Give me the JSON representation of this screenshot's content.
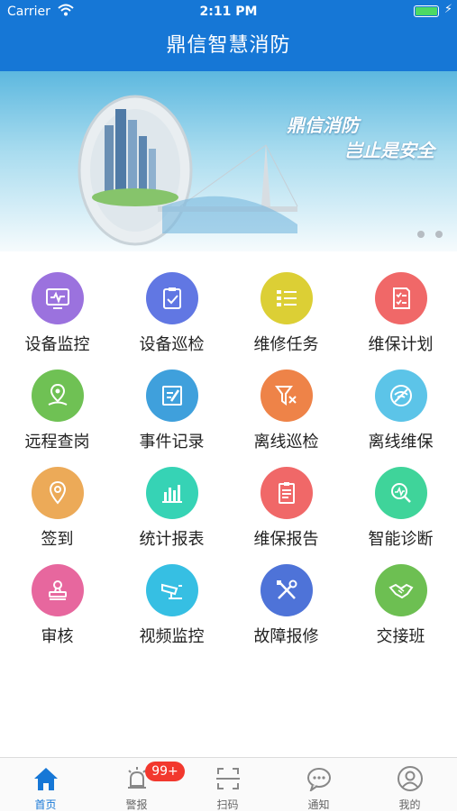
{
  "status_bar": {
    "carrier": "Carrier",
    "time": "2:11 PM"
  },
  "header": {
    "title": "鼎信智慧消防"
  },
  "banner": {
    "slogan_line1": "鼎信消防",
    "slogan_line2": "岂止是安全",
    "page_count": 2
  },
  "grid": {
    "items": [
      {
        "label": "设备监控",
        "icon": "monitor-icon",
        "color": "#9b72de"
      },
      {
        "label": "设备巡检",
        "icon": "clipboard-check-icon",
        "color": "#6177e3"
      },
      {
        "label": "维修任务",
        "icon": "list-icon",
        "color": "#dccf35"
      },
      {
        "label": "维保计划",
        "icon": "checklist-icon",
        "color": "#f06868"
      },
      {
        "label": "远程查岗",
        "icon": "map-pin-icon",
        "color": "#6fc154"
      },
      {
        "label": "事件记录",
        "icon": "edit-note-icon",
        "color": "#3fa0dc"
      },
      {
        "label": "离线巡检",
        "icon": "filter-off-icon",
        "color": "#ee8348"
      },
      {
        "label": "离线维保",
        "icon": "wifi-off-icon",
        "color": "#5cc4e8"
      },
      {
        "label": "签到",
        "icon": "location-icon",
        "color": "#ecaa58"
      },
      {
        "label": "统计报表",
        "icon": "bar-chart-icon",
        "color": "#36d3b5"
      },
      {
        "label": "维保报告",
        "icon": "report-icon",
        "color": "#f06868"
      },
      {
        "label": "智能诊断",
        "icon": "diagnosis-icon",
        "color": "#3fd49a"
      },
      {
        "label": "审核",
        "icon": "stamp-icon",
        "color": "#e7679e"
      },
      {
        "label": "视频监控",
        "icon": "cctv-camera-icon",
        "color": "#36bfe3"
      },
      {
        "label": "故障报修",
        "icon": "tools-icon",
        "color": "#4e73d8"
      },
      {
        "label": "交接班",
        "icon": "handshake-icon",
        "color": "#6dbf52"
      }
    ]
  },
  "tab_bar": {
    "tabs": [
      {
        "label": "首页",
        "icon": "home-icon",
        "active": true
      },
      {
        "label": "警报",
        "icon": "alarm-icon",
        "badge": "99+"
      },
      {
        "label": "扫码",
        "icon": "scan-icon"
      },
      {
        "label": "通知",
        "icon": "chat-bubble-icon"
      },
      {
        "label": "我的",
        "icon": "profile-icon"
      }
    ]
  },
  "colors": {
    "brand": "#1677d6",
    "active_tab": "#1677d6",
    "badge": "#f2382e"
  }
}
